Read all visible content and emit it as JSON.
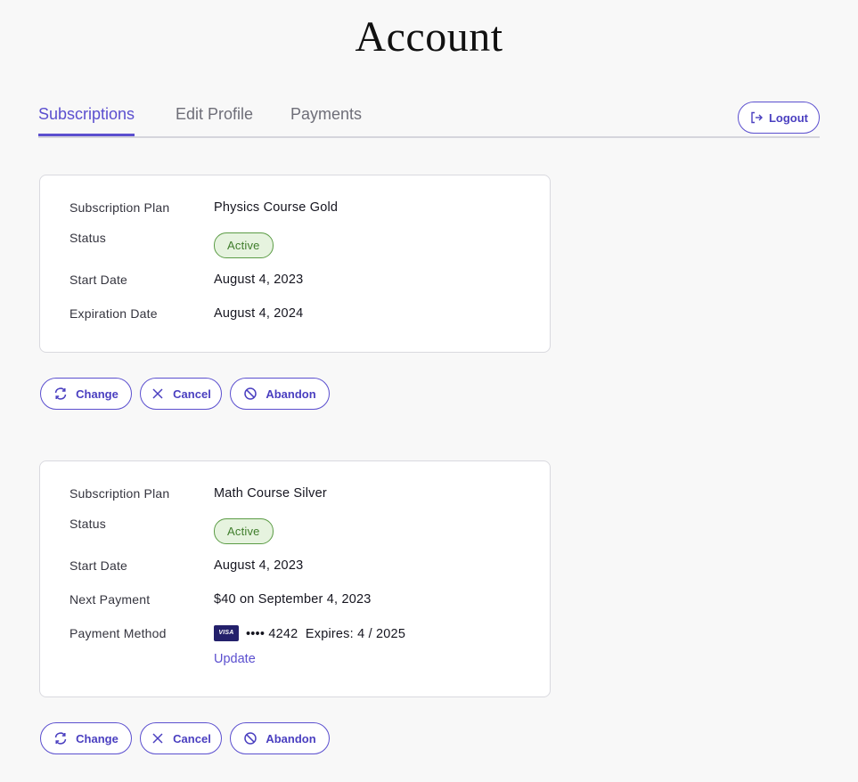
{
  "page": {
    "title": "Account"
  },
  "tabs": [
    {
      "label": "Subscriptions",
      "active": true
    },
    {
      "label": "Edit Profile",
      "active": false
    },
    {
      "label": "Payments",
      "active": false
    }
  ],
  "logout": {
    "label": "Logout",
    "icon": "logout-icon"
  },
  "labels": {
    "plan": "Subscription Plan",
    "status": "Status",
    "start": "Start Date",
    "expiration": "Expiration Date",
    "next_payment": "Next Payment",
    "payment_method": "Payment Method"
  },
  "subscriptions": [
    {
      "plan": "Physics Course Gold",
      "status": "Active",
      "start_date": "August 4, 2023",
      "expiration_date": "August 4, 2024"
    },
    {
      "plan": "Math Course Silver",
      "status": "Active",
      "start_date": "August 4, 2023",
      "next_payment": "$40 on September 4, 2023",
      "payment_method": {
        "brand": "VISA",
        "masked": "•••• 4242",
        "expires": "Expires: 4 / 2025",
        "update_label": "Update"
      }
    }
  ],
  "actions": {
    "change_label": "Change",
    "cancel_label": "Cancel",
    "abandon_label": "Abandon"
  },
  "colors": {
    "accent": "#5b4fcf",
    "badge_bg": "#e6f3df",
    "badge_border": "#5b9c45",
    "visa": "#23206b"
  }
}
